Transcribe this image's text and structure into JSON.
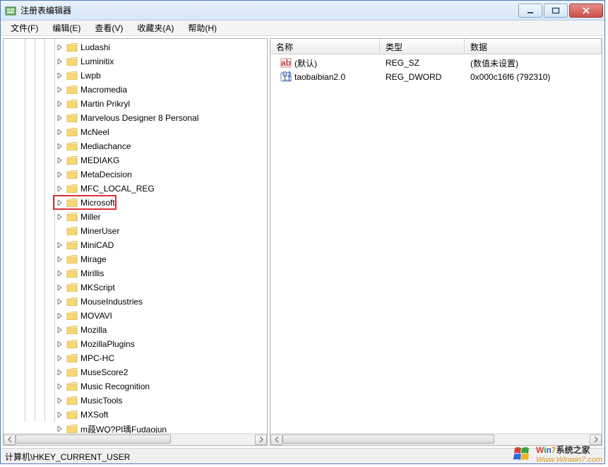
{
  "title": "注册表编辑器",
  "menus": [
    "文件(F)",
    "编辑(E)",
    "查看(V)",
    "收藏夹(A)",
    "帮助(H)"
  ],
  "tree": {
    "indent_base": 70,
    "items": [
      {
        "label": "Ludashi",
        "expander": true
      },
      {
        "label": "Luminitix",
        "expander": true
      },
      {
        "label": "Lwpb",
        "expander": true
      },
      {
        "label": "Macromedia",
        "expander": true
      },
      {
        "label": "Martin Prikryl",
        "expander": true
      },
      {
        "label": "Marvelous Designer 8 Personal",
        "expander": true
      },
      {
        "label": "McNeel",
        "expander": true
      },
      {
        "label": "Mediachance",
        "expander": true
      },
      {
        "label": "MEDIAKG",
        "expander": true
      },
      {
        "label": "MetaDecision",
        "expander": true
      },
      {
        "label": "MFC_LOCAL_REG",
        "expander": true
      },
      {
        "label": "Microsoft",
        "expander": true,
        "highlight": true
      },
      {
        "label": "Miller",
        "expander": true
      },
      {
        "label": "MinerUser",
        "expander": false
      },
      {
        "label": "MiniCAD",
        "expander": true
      },
      {
        "label": "Mirage",
        "expander": true
      },
      {
        "label": "Mirillis",
        "expander": true
      },
      {
        "label": "MKScript",
        "expander": true
      },
      {
        "label": "MouseIndustries",
        "expander": true
      },
      {
        "label": "MOVAVI",
        "expander": true
      },
      {
        "label": "Mozilla",
        "expander": true
      },
      {
        "label": "MozillaPlugins",
        "expander": true
      },
      {
        "label": "MPC-HC",
        "expander": true
      },
      {
        "label": "MuseScore2",
        "expander": true
      },
      {
        "label": "Music Recognition",
        "expander": true
      },
      {
        "label": "MusicTools",
        "expander": true
      },
      {
        "label": "MXSoft",
        "expander": true
      },
      {
        "label": "m葮WQ?Pl瑀Fudaojun",
        "expander": true
      }
    ]
  },
  "list": {
    "headers": {
      "name": "名称",
      "type": "类型",
      "data": "数据"
    },
    "rows": [
      {
        "icon": "string",
        "name": "(默认)",
        "type": "REG_SZ",
        "data": "(数值未设置)"
      },
      {
        "icon": "binary",
        "name": "taobaibian2.0",
        "type": "REG_DWORD",
        "data": "0x000c16f6 (792310)"
      }
    ]
  },
  "statusbar": "计算机\\HKEY_CURRENT_USER",
  "watermark": {
    "brand": "Win7系统之家",
    "url": "Www.Winwin7.com"
  }
}
